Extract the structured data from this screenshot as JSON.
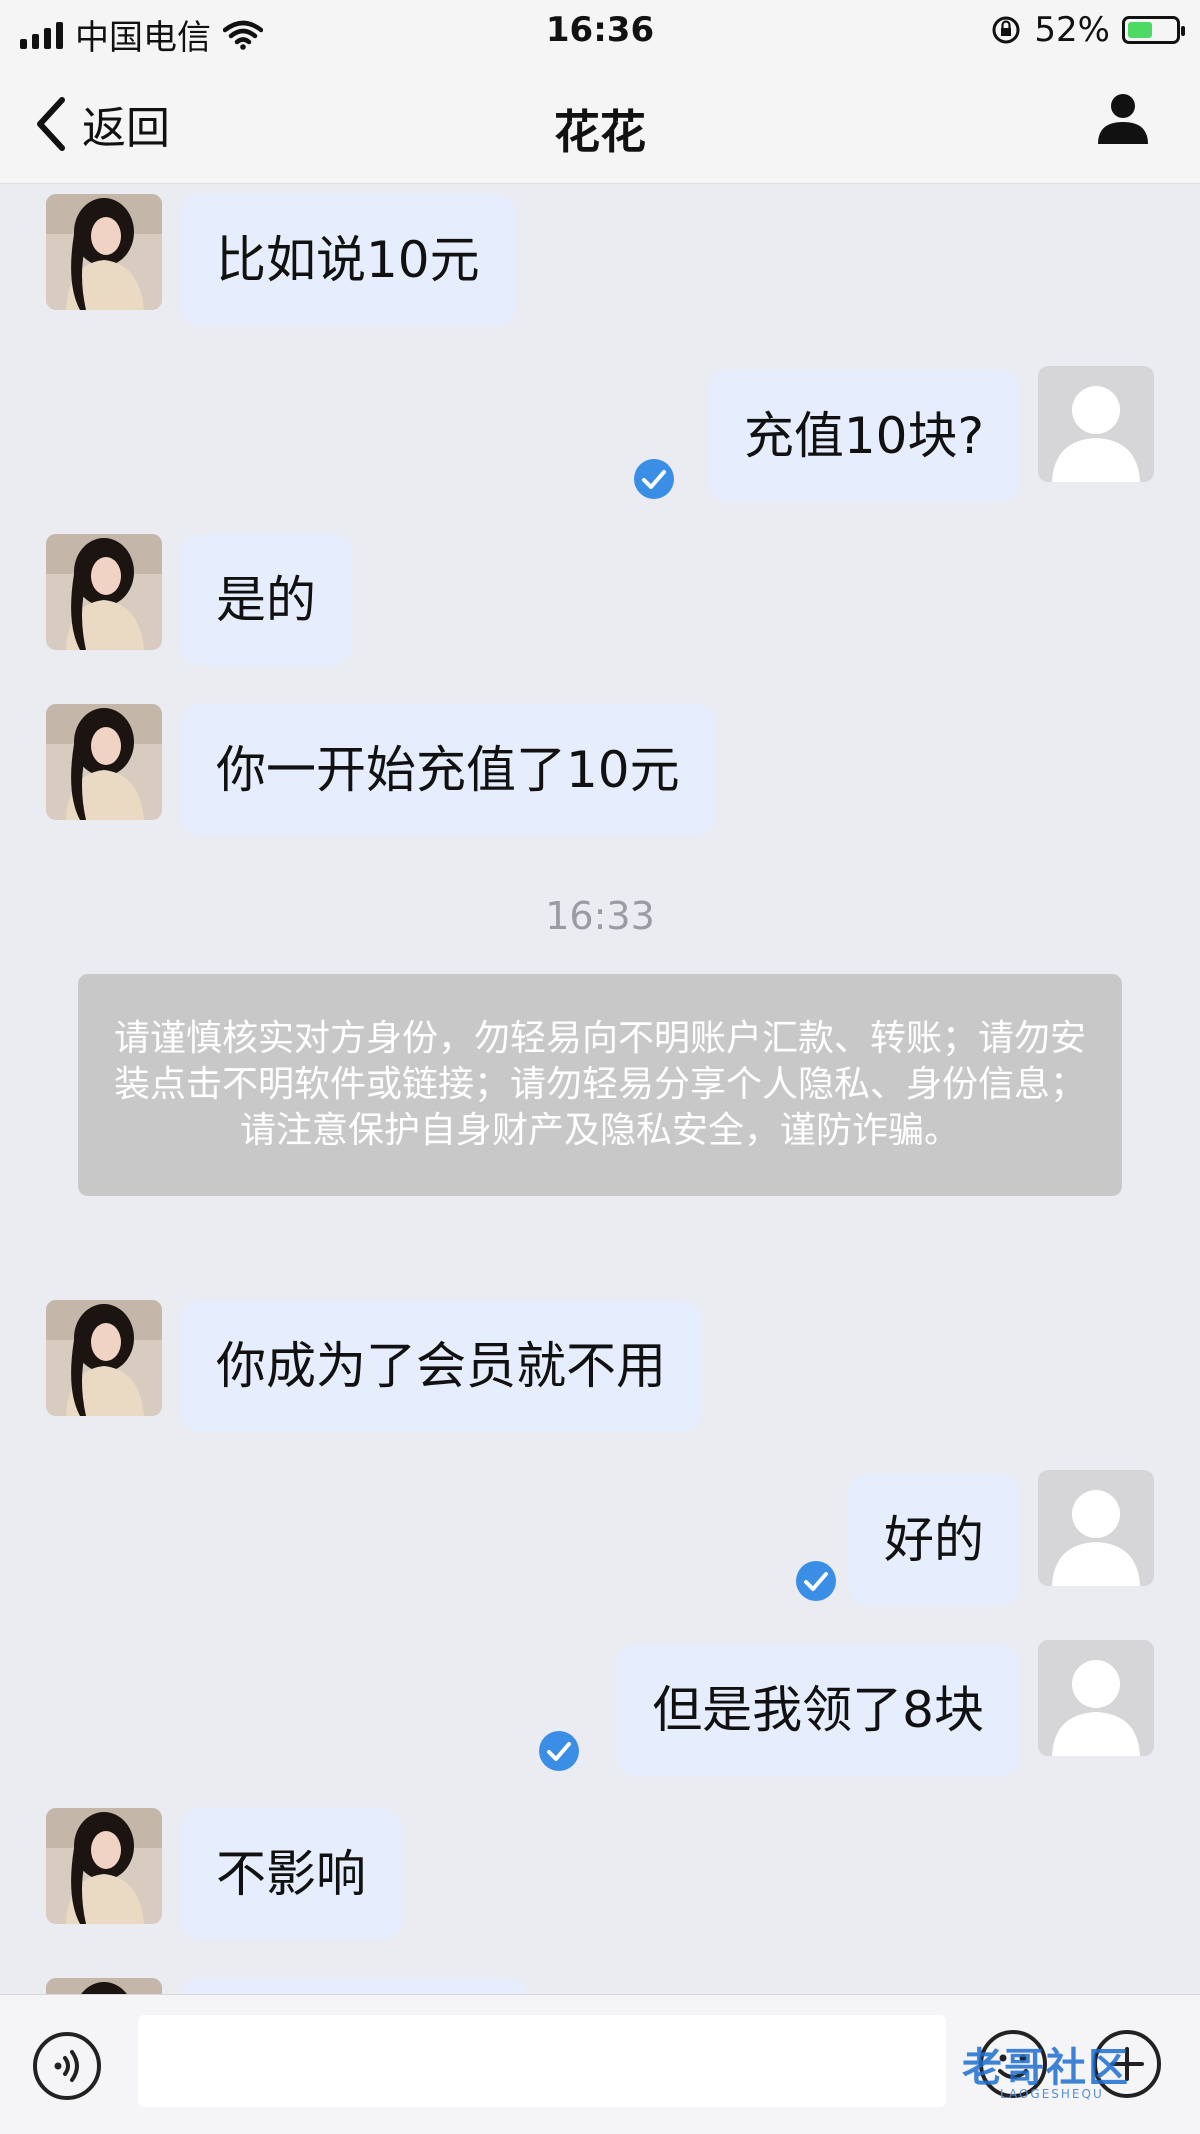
{
  "status_bar": {
    "carrier": "中国电信",
    "time": "16:36",
    "battery": "52%",
    "battery_level": 0.52
  },
  "nav": {
    "back_label": "返回",
    "title": "花花"
  },
  "messages": [
    {
      "side": "left",
      "text": "比如说10元"
    },
    {
      "side": "right",
      "text": "充值10块?",
      "read": true
    },
    {
      "side": "left",
      "text": "是的"
    },
    {
      "side": "left",
      "text": "你一开始充值了10元"
    },
    {
      "type": "timestamp",
      "text": "16:33"
    },
    {
      "type": "notice",
      "text": "请谨慎核实对方身份，勿轻易向不明账户汇款、转账；请勿安装点击不明软件或链接；请勿轻易分享个人隐私、身份信息；请注意保护自身财产及隐私安全，谨防诈骗。"
    },
    {
      "side": "left",
      "text": "你成为了会员就不用"
    },
    {
      "side": "right",
      "text": "好的",
      "read": true
    },
    {
      "side": "right",
      "text": "但是我领了8块",
      "read": true
    },
    {
      "side": "left",
      "text": "不影响"
    }
  ],
  "input_bar": {
    "text_value": "",
    "watermark": "老哥社区",
    "watermark_sub": "LAOGESHEQU"
  },
  "colors": {
    "bubble": "#e6edfc",
    "read_check": "#3a8ee6",
    "notice_bg": "#c8c8c8",
    "background": "#ebebf2"
  }
}
